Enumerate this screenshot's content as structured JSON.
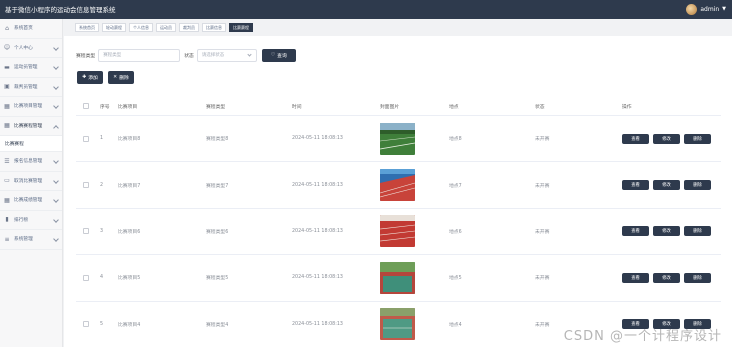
{
  "header": {
    "title": "基于微信小程序的运动会信息管理系统",
    "user": "admin"
  },
  "sidebar": {
    "items": [
      {
        "label": "系统首页",
        "icon": "home-icon"
      },
      {
        "label": "个人中心",
        "icon": "user-icon"
      },
      {
        "label": "运动员管理",
        "icon": "card-icon"
      },
      {
        "label": "裁判员管理",
        "icon": "badge-icon"
      },
      {
        "label": "比赛项目管理",
        "icon": "grid-icon"
      },
      {
        "label": "比赛赛程管理",
        "icon": "grid-icon",
        "open": true,
        "sub": "比赛赛程"
      },
      {
        "label": "报名信息管理",
        "icon": "list-icon"
      },
      {
        "label": "取消比赛管理",
        "icon": "chat-icon"
      },
      {
        "label": "比赛成绩管理",
        "icon": "grid-icon"
      },
      {
        "label": "排行榜",
        "icon": "chart-icon"
      },
      {
        "label": "系统管理",
        "icon": "menu-icon"
      }
    ]
  },
  "tabs": [
    "系统首页",
    "轮动赛程",
    "个人信息",
    "运动员",
    "裁判员",
    "比赛信息",
    "比赛赛程"
  ],
  "search": {
    "type_label": "赛程类型",
    "type_placeholder": "赛程类型",
    "status_label": "状态",
    "status_placeholder": "请选择状态",
    "query_button": "查询"
  },
  "actions": {
    "add": "添加",
    "delete": "删除"
  },
  "table": {
    "headers": {
      "index": "序号",
      "name": "比赛项目",
      "type": "赛程类型",
      "time": "时间",
      "image": "封面图片",
      "venue": "地点",
      "status": "状态",
      "ops": "操作"
    },
    "rows": [
      {
        "index": "1",
        "name": "比赛项目8",
        "type": "赛程类型8",
        "time": "2024-05-11 18:08:13",
        "image": "field",
        "venue": "地点8",
        "status": "未开赛"
      },
      {
        "index": "2",
        "name": "比赛项目7",
        "type": "赛程类型7",
        "time": "2024-05-11 18:08:13",
        "image": "track",
        "venue": "地点7",
        "status": "未开赛"
      },
      {
        "index": "3",
        "name": "比赛项目6",
        "type": "赛程类型6",
        "time": "2024-05-11 18:08:13",
        "image": "redtrack",
        "venue": "地点6",
        "status": "未开赛"
      },
      {
        "index": "4",
        "name": "比赛项目5",
        "type": "赛程类型5",
        "time": "2024-05-11 18:08:13",
        "image": "court",
        "venue": "地点5",
        "status": "未开赛"
      },
      {
        "index": "5",
        "name": "比赛项目4",
        "type": "赛程类型4",
        "time": "2024-05-11 18:08:13",
        "image": "court2",
        "venue": "地点4",
        "status": "未开赛"
      }
    ],
    "row_buttons": {
      "view": "查看",
      "edit": "修改",
      "delete": "删除"
    }
  },
  "watermark": "CSDN @一个计程序设计",
  "colors": {
    "topbar": "#2e3a4d",
    "button": "#2e3a4d"
  }
}
